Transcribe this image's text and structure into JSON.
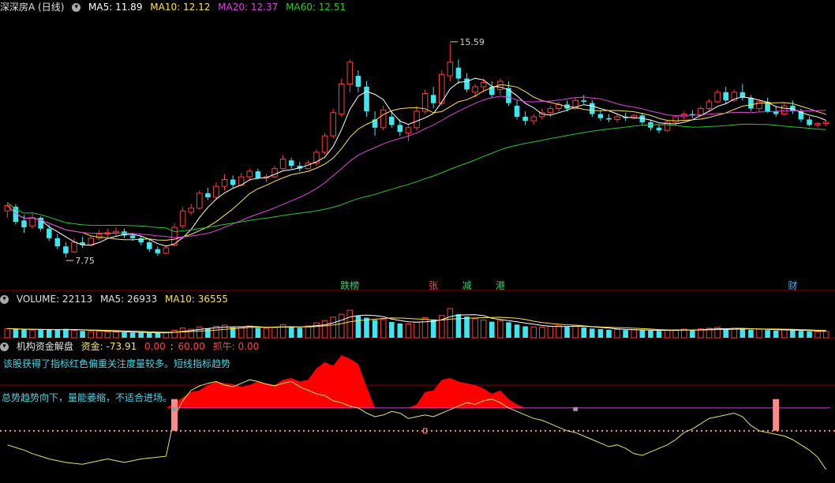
{
  "header_main": {
    "title": "深深房A (日线)",
    "ma5": "MA5: 11.89",
    "ma10": "MA10: 12.12",
    "ma20": "MA20: 12.37",
    "ma60": "MA60: 12.51"
  },
  "header_volume": {
    "volume": "VOLUME: 22113",
    "ma5": "MA5: 26933",
    "ma10": "MA10: 36555"
  },
  "header_indicator": {
    "name": "机构资金解盘",
    "fund": "资金: -73.91",
    "v1": "0.00",
    "v2": "60.00",
    "catch": "抓牛: 0.00"
  },
  "notes": {
    "overlap_line": "该股获得了指标红色偏重关注度量较多。短线指标趋势",
    "trend": "总势趋势向下，量能萎缩，不适合进场。"
  },
  "markers": [
    {
      "index": 41,
      "label": "跌榜",
      "color": "#2fd36a"
    },
    {
      "index": 51,
      "label": "张",
      "color": "#ff4444"
    },
    {
      "index": 55,
      "label": "减",
      "color": "#2fd36a"
    },
    {
      "index": 59,
      "label": "港",
      "color": "#2fd36a"
    },
    {
      "index": 94,
      "label": "财",
      "color": "#3ab8ff"
    }
  ],
  "colors": {
    "up": "#ff3b3b",
    "down": "#3fe6f0",
    "ma5": "#ffffff",
    "ma10": "#ffe24a",
    "ma20": "#e040e0",
    "ma60": "#26c826",
    "fund": "#ff0000",
    "line": "#e6e65a"
  },
  "chart_data": [
    {
      "type": "candlestick",
      "title": "深深房A (日线)",
      "ylim": [
        7.0,
        16.6
      ],
      "annotations": [
        {
          "index": 53,
          "value": 15.59,
          "label": "15.59",
          "kind": "high"
        },
        {
          "index": 7,
          "value": 7.75,
          "label": "7.75",
          "kind": "low"
        }
      ],
      "ohlc": [
        [
          9.45,
          9.75,
          9.2,
          9.65
        ],
        [
          9.6,
          9.7,
          8.95,
          9.05
        ],
        [
          9.1,
          9.3,
          8.65,
          8.85
        ],
        [
          8.9,
          9.35,
          8.8,
          9.2
        ],
        [
          9.2,
          9.25,
          8.7,
          8.8
        ],
        [
          8.8,
          8.95,
          8.35,
          8.45
        ],
        [
          8.45,
          8.6,
          8.05,
          8.15
        ],
        [
          8.15,
          8.3,
          7.75,
          7.9
        ],
        [
          7.95,
          8.45,
          7.9,
          8.3
        ],
        [
          8.3,
          8.5,
          8.1,
          8.2
        ],
        [
          8.2,
          8.55,
          8.15,
          8.45
        ],
        [
          8.45,
          8.75,
          8.35,
          8.6
        ],
        [
          8.6,
          8.8,
          8.5,
          8.65
        ],
        [
          8.65,
          8.85,
          8.55,
          8.7
        ],
        [
          8.7,
          8.8,
          8.45,
          8.55
        ],
        [
          8.55,
          8.65,
          8.35,
          8.45
        ],
        [
          8.45,
          8.55,
          8.2,
          8.3
        ],
        [
          8.3,
          8.4,
          7.95,
          8.05
        ],
        [
          8.05,
          8.15,
          7.8,
          7.9
        ],
        [
          7.9,
          8.2,
          7.85,
          8.1
        ],
        [
          8.2,
          9.0,
          8.15,
          8.85
        ],
        [
          8.9,
          9.6,
          8.8,
          9.45
        ],
        [
          9.4,
          9.7,
          9.3,
          9.55
        ],
        [
          9.55,
          10.2,
          9.5,
          10.1
        ],
        [
          10.1,
          10.3,
          9.85,
          9.95
        ],
        [
          9.95,
          10.5,
          9.9,
          10.35
        ],
        [
          10.35,
          10.8,
          10.2,
          10.6
        ],
        [
          10.6,
          10.75,
          10.3,
          10.4
        ],
        [
          10.4,
          10.85,
          10.35,
          10.7
        ],
        [
          10.7,
          11.0,
          10.55,
          10.9
        ],
        [
          10.9,
          11.0,
          10.6,
          10.65
        ],
        [
          10.65,
          10.8,
          10.5,
          10.7
        ],
        [
          10.7,
          11.1,
          10.65,
          11.0
        ],
        [
          11.0,
          11.5,
          10.95,
          11.35
        ],
        [
          11.3,
          11.4,
          11.0,
          11.1
        ],
        [
          11.1,
          11.25,
          10.9,
          11.0
        ],
        [
          11.0,
          11.3,
          10.95,
          11.2
        ],
        [
          11.2,
          11.7,
          11.1,
          11.6
        ],
        [
          11.6,
          12.3,
          11.5,
          12.2
        ],
        [
          12.2,
          13.2,
          12.1,
          13.05
        ],
        [
          13.0,
          14.3,
          12.9,
          14.1
        ],
        [
          14.1,
          15.0,
          13.8,
          14.9
        ],
        [
          14.4,
          14.6,
          13.8,
          14.0
        ],
        [
          14.0,
          14.2,
          12.9,
          13.1
        ],
        [
          12.8,
          13.1,
          12.2,
          12.5
        ],
        [
          12.5,
          13.3,
          12.4,
          13.15
        ],
        [
          12.9,
          13.1,
          12.5,
          12.6
        ],
        [
          12.6,
          12.8,
          12.2,
          12.35
        ],
        [
          12.3,
          12.6,
          12.0,
          12.5
        ],
        [
          12.5,
          13.3,
          12.4,
          13.1
        ],
        [
          13.1,
          13.9,
          13.0,
          13.75
        ],
        [
          13.7,
          14.0,
          13.2,
          13.4
        ],
        [
          13.4,
          14.6,
          13.3,
          14.45
        ],
        [
          14.4,
          15.59,
          14.2,
          14.9
        ],
        [
          14.7,
          15.0,
          14.1,
          14.3
        ],
        [
          14.3,
          14.5,
          13.8,
          13.9
        ],
        [
          13.8,
          14.1,
          13.6,
          14.0
        ],
        [
          14.0,
          14.3,
          13.8,
          14.15
        ],
        [
          14.0,
          14.2,
          13.6,
          13.7
        ],
        [
          13.9,
          14.3,
          13.7,
          14.2
        ],
        [
          13.95,
          14.2,
          13.3,
          13.4
        ],
        [
          13.3,
          13.5,
          12.8,
          12.9
        ],
        [
          12.9,
          13.1,
          12.6,
          12.75
        ],
        [
          12.75,
          13.0,
          12.6,
          12.9
        ],
        [
          12.9,
          13.2,
          12.8,
          13.05
        ],
        [
          13.05,
          13.3,
          12.9,
          13.2
        ],
        [
          13.2,
          13.45,
          13.1,
          13.35
        ],
        [
          13.35,
          13.5,
          13.1,
          13.2
        ],
        [
          13.2,
          13.6,
          13.15,
          13.5
        ],
        [
          13.5,
          13.7,
          13.35,
          13.45
        ],
        [
          13.4,
          13.5,
          12.9,
          13.0
        ],
        [
          13.0,
          13.15,
          12.75,
          12.85
        ],
        [
          12.85,
          13.0,
          12.7,
          12.8
        ],
        [
          12.8,
          13.0,
          12.7,
          12.9
        ],
        [
          12.9,
          13.05,
          12.75,
          12.85
        ],
        [
          12.85,
          13.0,
          12.8,
          12.95
        ],
        [
          12.95,
          13.05,
          12.6,
          12.7
        ],
        [
          12.7,
          12.8,
          12.4,
          12.5
        ],
        [
          12.5,
          12.6,
          12.3,
          12.4
        ],
        [
          12.4,
          12.8,
          12.35,
          12.7
        ],
        [
          12.7,
          12.95,
          12.6,
          12.9
        ],
        [
          12.9,
          13.1,
          12.8,
          13.0
        ],
        [
          13.0,
          13.15,
          12.85,
          12.95
        ],
        [
          12.95,
          13.3,
          12.9,
          13.2
        ],
        [
          13.2,
          13.55,
          13.1,
          13.45
        ],
        [
          13.45,
          13.9,
          13.4,
          13.8
        ],
        [
          13.8,
          14.0,
          13.4,
          13.5
        ],
        [
          13.5,
          13.9,
          13.45,
          13.8
        ],
        [
          13.8,
          14.1,
          13.5,
          13.6
        ],
        [
          13.6,
          13.7,
          13.1,
          13.2
        ],
        [
          13.2,
          13.5,
          13.1,
          13.45
        ],
        [
          13.45,
          13.6,
          13.05,
          13.1
        ],
        [
          13.1,
          13.3,
          12.9,
          13.0
        ],
        [
          13.0,
          13.4,
          12.95,
          13.3
        ],
        [
          13.3,
          13.5,
          13.0,
          13.1
        ],
        [
          13.1,
          13.2,
          12.7,
          12.8
        ],
        [
          12.8,
          12.9,
          12.55,
          12.6
        ],
        [
          12.6,
          12.7,
          12.5,
          12.65
        ],
        [
          12.65,
          12.75,
          12.55,
          12.7
        ]
      ],
      "series": [
        {
          "name": "MA5",
          "key": "ma5"
        },
        {
          "name": "MA10",
          "key": "ma10"
        },
        {
          "name": "MA20",
          "key": "ma20"
        },
        {
          "name": "MA60",
          "key": "ma60"
        }
      ]
    },
    {
      "type": "bar",
      "title": "VOLUME",
      "ylim": [
        0,
        110000
      ],
      "values": [
        32000,
        30000,
        29000,
        27000,
        28000,
        29000,
        27000,
        31000,
        26000,
        24000,
        22000,
        23000,
        21000,
        20000,
        19000,
        18000,
        17500,
        17000,
        16500,
        18000,
        26000,
        34000,
        30000,
        38000,
        33000,
        40000,
        44000,
        36000,
        38000,
        41000,
        34000,
        33000,
        36000,
        46000,
        38000,
        35000,
        41000,
        52000,
        60000,
        72000,
        82000,
        96000,
        76000,
        70000,
        62000,
        64000,
        55000,
        50000,
        48000,
        55000,
        70000,
        64000,
        78000,
        102000,
        82000,
        74000,
        66000,
        62000,
        56000,
        60000,
        54000,
        46000,
        40000,
        38000,
        37000,
        40000,
        42000,
        38000,
        44000,
        36000,
        32000,
        30000,
        28000,
        29000,
        27000,
        28000,
        26000,
        25000,
        24000,
        26000,
        28000,
        30000,
        27000,
        31000,
        33000,
        36000,
        30000,
        33000,
        31000,
        28000,
        30000,
        27000,
        25000,
        28000,
        26000,
        24000,
        22000,
        21000,
        22113
      ],
      "series": [
        {
          "name": "MA5",
          "key": "vma5"
        },
        {
          "name": "MA10",
          "key": "vma10"
        }
      ]
    },
    {
      "type": "area",
      "title": "机构资金解盘",
      "ylim": [
        -80,
        60
      ],
      "fund": [
        0,
        0,
        0,
        0,
        0,
        0,
        0,
        0,
        0,
        0,
        0,
        0,
        0,
        0,
        0,
        0,
        0,
        0,
        0,
        0,
        5,
        12,
        18,
        20,
        26,
        30,
        28,
        27,
        24,
        26,
        30,
        28,
        26,
        32,
        34,
        30,
        32,
        45,
        52,
        48,
        60,
        56,
        50,
        24,
        0,
        0,
        0,
        0,
        0,
        4,
        18,
        20,
        32,
        34,
        30,
        28,
        26,
        22,
        16,
        20,
        10,
        4,
        0,
        0,
        0,
        0,
        0,
        0,
        0,
        0,
        0,
        0,
        0,
        0,
        0,
        0,
        0,
        0,
        0,
        0,
        0,
        0,
        0,
        0,
        0,
        0,
        0,
        0,
        0,
        0,
        0,
        0,
        0,
        0,
        0,
        0,
        0,
        0,
        0
      ],
      "line": [
        -42,
        -45,
        -48,
        -52,
        -55,
        -58,
        -60,
        -62,
        -63,
        -64,
        -62,
        -60,
        -58,
        -60,
        -62,
        -60,
        -58,
        -57,
        -56,
        -55,
        -10,
        8,
        20,
        25,
        28,
        30,
        26,
        24,
        28,
        32,
        30,
        27,
        25,
        28,
        30,
        24,
        20,
        16,
        14,
        8,
        6,
        2,
        0,
        -6,
        -10,
        -8,
        -4,
        -6,
        -12,
        -10,
        -8,
        -10,
        -6,
        -2,
        2,
        6,
        4,
        8,
        10,
        6,
        0,
        -4,
        -8,
        -12,
        -14,
        -18,
        -22,
        -26,
        -28,
        -32,
        -36,
        -40,
        -44,
        -42,
        -46,
        -52,
        -54,
        -50,
        -46,
        -42,
        -36,
        -28,
        -24,
        -18,
        -12,
        -10,
        -8,
        -6,
        -10,
        -20,
        -26,
        -28,
        -30,
        -32,
        -36,
        -42,
        -48,
        -56,
        -70
      ],
      "signals": [
        20,
        92
      ],
      "signal_marks": [
        {
          "index": 20,
          "kind": "gray"
        },
        {
          "index": 68,
          "kind": "gray"
        },
        {
          "index": 50,
          "kind": "pink"
        }
      ]
    }
  ]
}
